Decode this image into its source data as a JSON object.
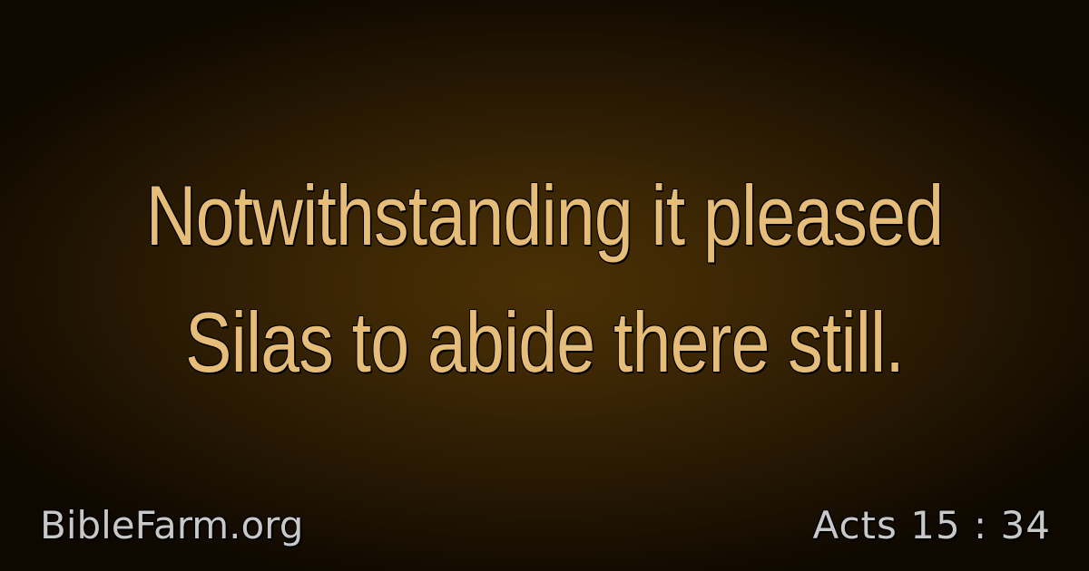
{
  "verse": {
    "line1": "Notwithstanding it pleased",
    "line2": "Silas to abide there still."
  },
  "footer": {
    "site": "BibleFarm.org",
    "reference": "Acts 15 : 34"
  },
  "colors": {
    "verse_text": "#e6bd78",
    "footer_text": "#c8c8c8",
    "background_center": "#4a3004",
    "background_edge": "#0e0800"
  }
}
